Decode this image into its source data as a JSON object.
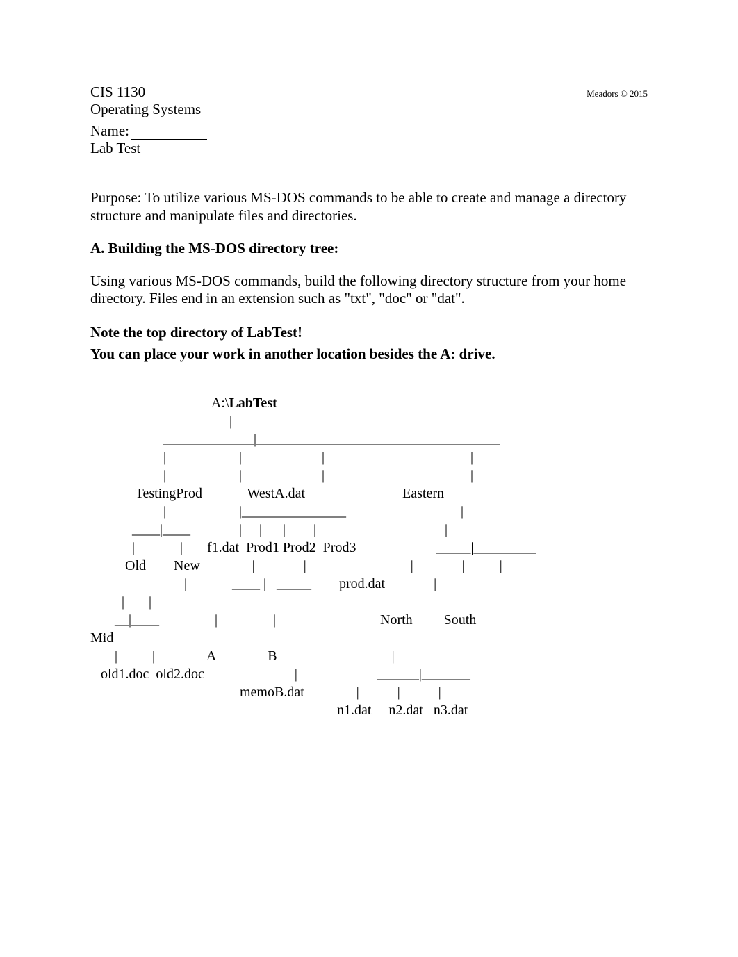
{
  "header": {
    "course": "CIS 1130",
    "copyright": "Meadors © 2015",
    "subject": "Operating Systems",
    "name_label": "Name:",
    "labtest": "Lab Test"
  },
  "purpose": "Purpose: To utilize various MS-DOS commands to be able to create and manage a directory structure and manipulate files and directories.",
  "sectionA_heading": "A.  Building the MS-DOS directory tree:",
  "sectionA_para": "Using various MS-DOS commands, build the following directory structure from your home directory.  Files end in an extension such as \"txt\", \"doc\" or \"dat\".",
  "note_line1": "Note the top directory of LabTest!",
  "note_line2": "You can place your work in another location besides the A: drive.",
  "tree": {
    "root_prefix": "A:\\",
    "root_name": "LabTest",
    "line2": "                                        |",
    "line3": "                     _____________|___________________________________",
    "line4": "                     |                     |                       |                                          |",
    "line5": "                     |                     |                       |                                          |",
    "line6": "             TestingProd             WestA.dat                            Eastern",
    "line7": "                     |                     |_______________                                 |",
    "line8": "            ____|____              |     |      |        |                                     |",
    "line9": "            |             |       f1.dat  Prod1 Prod2  Prod3                       _____|_________",
    "line10": "          Old        New               |              |                              |              |          |",
    "line11": "                           |             ____ |   _____        prod.dat              |",
    "line12": "         |       |",
    "line13": "       __|____                |                |                              North         South",
    "line14": "Mid",
    "line15": "       |          |               A               B                                 |",
    "line16": "   old1.doc  old2.doc                          |                       ______|_______",
    "line17": "                                           memoB.dat               |           |           |",
    "line18": "                                                                       n1.dat     n2.dat   n3.dat"
  }
}
